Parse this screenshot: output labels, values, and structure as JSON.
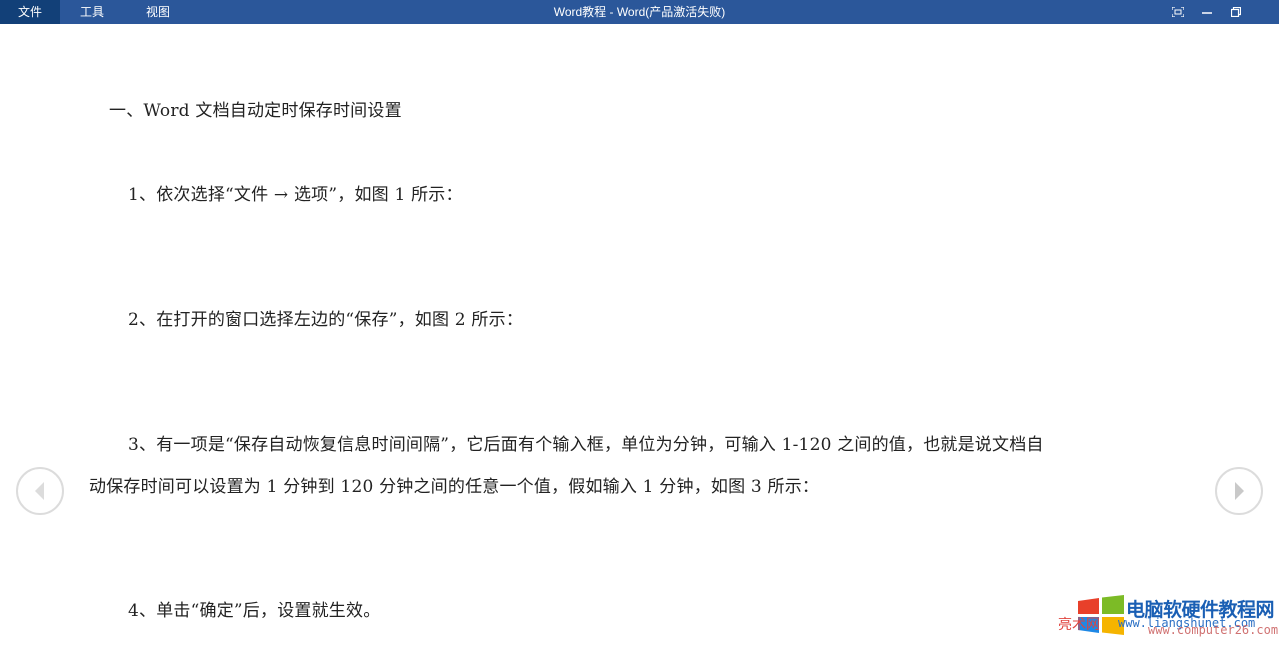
{
  "menu": {
    "items": [
      {
        "label": "文件"
      },
      {
        "label": "工具"
      },
      {
        "label": "视图"
      }
    ]
  },
  "window": {
    "title": "Word教程 - Word(产品激活失败)"
  },
  "icons": {
    "fullscreen": "fullscreen-icon",
    "minimize": "minimize-icon",
    "restore": "restore-icon",
    "prev": "chevron-left-icon",
    "next": "chevron-right-icon"
  },
  "document": {
    "heading": "一、Word 文档自动定时保存时间设置",
    "p1": "1、依次选择“文件 → 选项”，如图 1 所示：",
    "p2": "2、在打开的窗口选择左边的“保存”，如图 2 所示：",
    "p3_line1": "3、有一项是“保存自动恢复信息时间间隔”，它后面有个输入框，单位为分钟，可输入 1-120 之间的值，也就是说文档自",
    "p3_line2": "动保存时间可以设置为 1 分钟到 120 分钟之间的任意一个值，假如输入 1 分钟，如图 3 所示：",
    "p4": "4、单击“确定”后，设置就生效。"
  },
  "watermark": {
    "title": "电脑软硬件教程网",
    "prefix": "亮术网",
    "url1": "www.liangshunet.com",
    "url2": "www.computer26.com"
  },
  "colors": {
    "titlebar": "#2b579a",
    "active_menu": "#124078",
    "nav_border": "#dcdcdc"
  }
}
